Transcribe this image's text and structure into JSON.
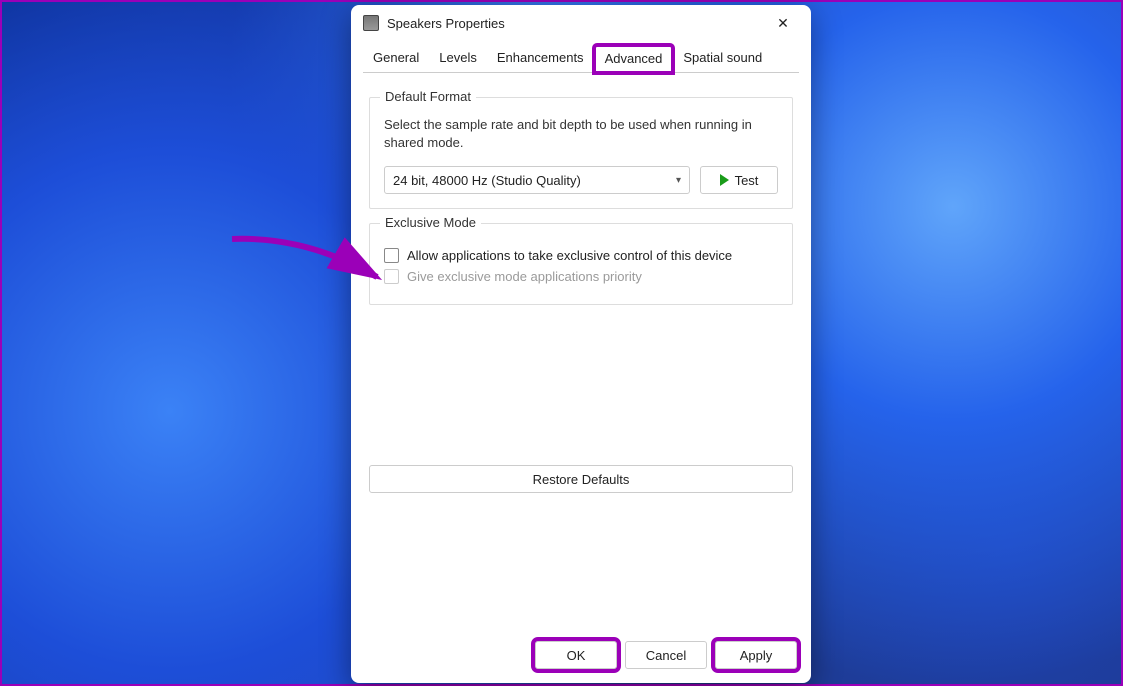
{
  "dialog": {
    "title": "Speakers Properties",
    "close": "✕"
  },
  "tabs": {
    "general": "General",
    "levels": "Levels",
    "enhancements": "Enhancements",
    "advanced": "Advanced",
    "spatial": "Spatial sound"
  },
  "defaultFormat": {
    "legend": "Default Format",
    "description": "Select the sample rate and bit depth to be used when running in shared mode.",
    "selected": "24 bit, 48000 Hz (Studio Quality)",
    "testLabel": "Test"
  },
  "exclusiveMode": {
    "legend": "Exclusive Mode",
    "option1": "Allow applications to take exclusive control of this device",
    "option2": "Give exclusive mode applications priority"
  },
  "restoreDefaults": "Restore Defaults",
  "buttons": {
    "ok": "OK",
    "cancel": "Cancel",
    "apply": "Apply"
  }
}
